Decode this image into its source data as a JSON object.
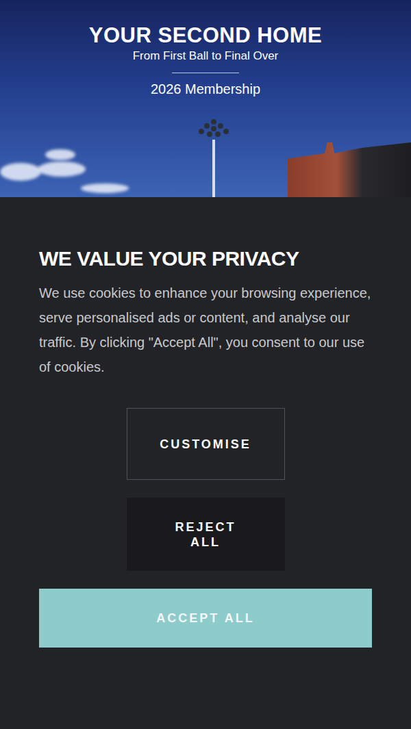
{
  "hero": {
    "title": "YOUR SECOND HOME",
    "subtitle": "From First Ball to Final Over",
    "caption": "2026 Membership"
  },
  "consent": {
    "title": "WE VALUE YOUR PRIVACY",
    "body": "We use cookies to enhance your browsing experience, serve personalised ads or content, and analyse our traffic. By clicking \"Accept All\", you consent to our use of cookies.",
    "buttons": [
      {
        "label": "CUSTOMISE",
        "kind": "outline"
      },
      {
        "label": "REJECT ALL",
        "kind": "dark"
      },
      {
        "label": "ACCEPT ALL",
        "kind": "primary"
      }
    ]
  }
}
